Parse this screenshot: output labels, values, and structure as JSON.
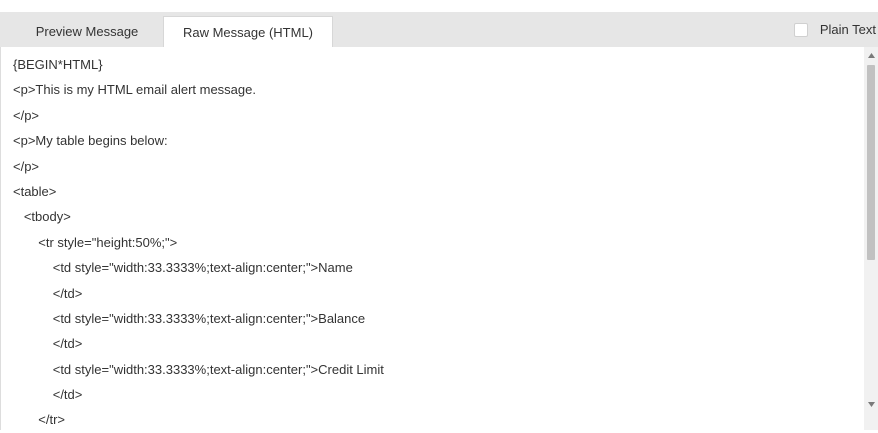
{
  "tabs": {
    "preview_label": "Preview Message",
    "raw_label": "Raw Message (HTML)"
  },
  "plain_text": {
    "label": "Plain Text",
    "checked": false
  },
  "code_lines": [
    "{BEGIN*HTML}",
    "<p>This is my HTML email alert message.",
    "</p>",
    "<p>My table begins below:",
    "</p>",
    "<table>",
    "   <tbody>",
    "       <tr style=\"height:50%;\">",
    "           <td style=\"width:33.3333%;text-align:center;\">Name",
    "           </td>",
    "           <td style=\"width:33.3333%;text-align:center;\">Balance",
    "           </td>",
    "           <td style=\"width:33.3333%;text-align:center;\">Credit Limit",
    "           </td>",
    "       </tr>"
  ],
  "colors": {
    "tabbar_bg": "#e6e6e6",
    "active_tab_bg": "#ffffff",
    "scroll_thumb": "#c1c1c1"
  },
  "icons": {
    "scroll_up": "triangle-up-icon",
    "scroll_down": "triangle-down-icon"
  }
}
